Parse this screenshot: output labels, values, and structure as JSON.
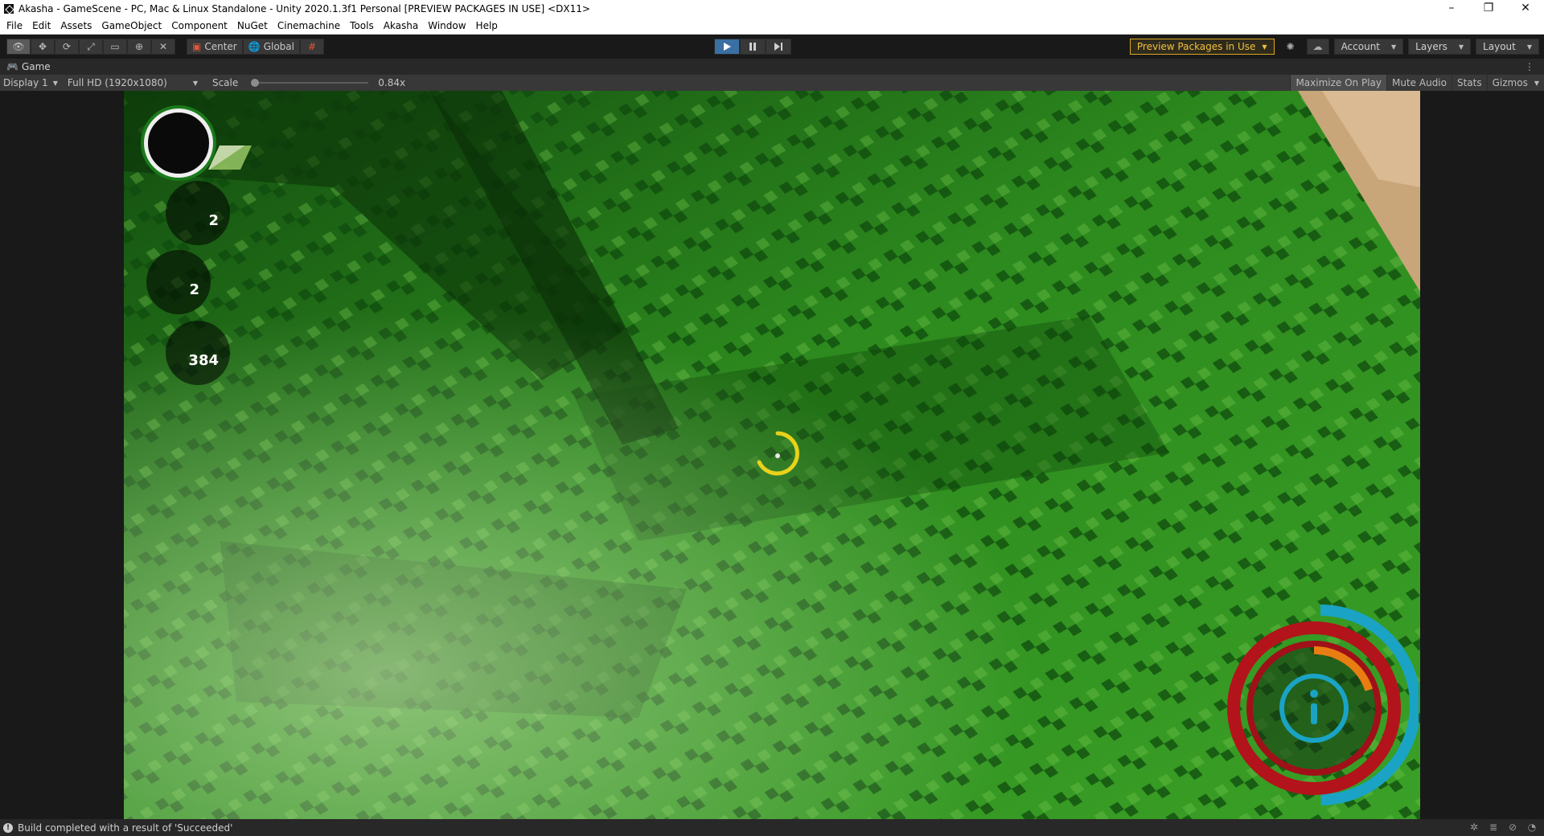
{
  "window": {
    "title": "Akasha - GameScene - PC, Mac & Linux Standalone - Unity 2020.1.3f1 Personal [PREVIEW PACKAGES IN USE] <DX11>",
    "minimize": "–",
    "maximize": "❐",
    "close": "✕"
  },
  "menu": [
    "File",
    "Edit",
    "Assets",
    "GameObject",
    "Component",
    "NuGet",
    "Cinemachine",
    "Tools",
    "Akasha",
    "Window",
    "Help"
  ],
  "toolbar": {
    "pivot_mode": "Center",
    "pivot_rotation": "Global",
    "preview_packages": "Preview Packages in Use",
    "account": "Account",
    "layers": "Layers",
    "layout": "Layout"
  },
  "game_tab": {
    "label": "Game"
  },
  "game_bar": {
    "display": "Display 1",
    "resolution": "Full HD (1920x1080)",
    "scale_label": "Scale",
    "scale_value": "0.84x",
    "maximize_on_play": "Maximize On Play",
    "mute_audio": "Mute Audio",
    "stats": "Stats",
    "gizmos": "Gizmos"
  },
  "hud": {
    "counters": [
      "2",
      "2",
      "384"
    ]
  },
  "status": {
    "message": "Build completed with a result of 'Succeeded'"
  },
  "colors": {
    "accent_play": "#3a6fa3",
    "preview_warning": "#f0c040",
    "grass": "#2f8a1c",
    "crosshair": "#e8d21a",
    "ring_red": "#b3131a",
    "ring_blue": "#1aa3c4",
    "ring_orange": "#e87d12"
  }
}
